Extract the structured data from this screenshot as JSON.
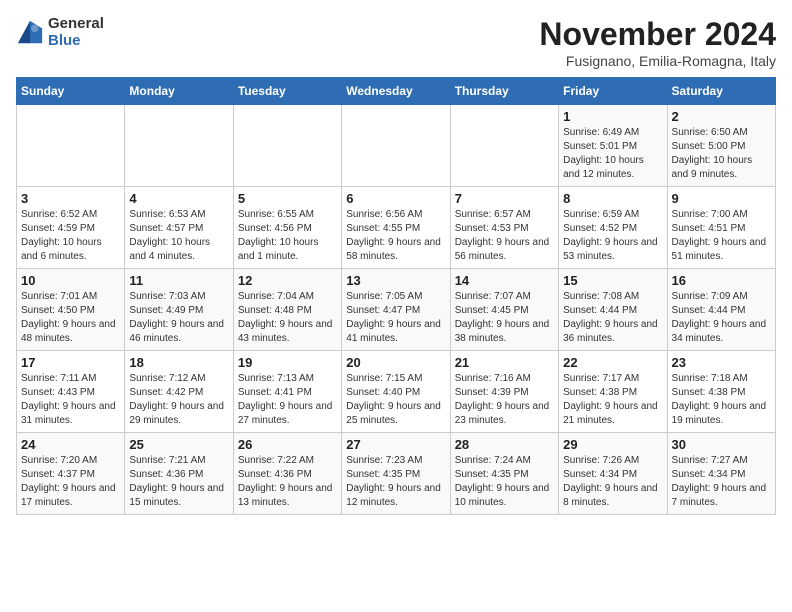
{
  "logo": {
    "general": "General",
    "blue": "Blue"
  },
  "title": "November 2024",
  "subtitle": "Fusignano, Emilia-Romagna, Italy",
  "headers": [
    "Sunday",
    "Monday",
    "Tuesday",
    "Wednesday",
    "Thursday",
    "Friday",
    "Saturday"
  ],
  "weeks": [
    [
      {
        "day": "",
        "info": ""
      },
      {
        "day": "",
        "info": ""
      },
      {
        "day": "",
        "info": ""
      },
      {
        "day": "",
        "info": ""
      },
      {
        "day": "",
        "info": ""
      },
      {
        "day": "1",
        "info": "Sunrise: 6:49 AM\nSunset: 5:01 PM\nDaylight: 10 hours and 12 minutes."
      },
      {
        "day": "2",
        "info": "Sunrise: 6:50 AM\nSunset: 5:00 PM\nDaylight: 10 hours and 9 minutes."
      }
    ],
    [
      {
        "day": "3",
        "info": "Sunrise: 6:52 AM\nSunset: 4:59 PM\nDaylight: 10 hours and 6 minutes."
      },
      {
        "day": "4",
        "info": "Sunrise: 6:53 AM\nSunset: 4:57 PM\nDaylight: 10 hours and 4 minutes."
      },
      {
        "day": "5",
        "info": "Sunrise: 6:55 AM\nSunset: 4:56 PM\nDaylight: 10 hours and 1 minute."
      },
      {
        "day": "6",
        "info": "Sunrise: 6:56 AM\nSunset: 4:55 PM\nDaylight: 9 hours and 58 minutes."
      },
      {
        "day": "7",
        "info": "Sunrise: 6:57 AM\nSunset: 4:53 PM\nDaylight: 9 hours and 56 minutes."
      },
      {
        "day": "8",
        "info": "Sunrise: 6:59 AM\nSunset: 4:52 PM\nDaylight: 9 hours and 53 minutes."
      },
      {
        "day": "9",
        "info": "Sunrise: 7:00 AM\nSunset: 4:51 PM\nDaylight: 9 hours and 51 minutes."
      }
    ],
    [
      {
        "day": "10",
        "info": "Sunrise: 7:01 AM\nSunset: 4:50 PM\nDaylight: 9 hours and 48 minutes."
      },
      {
        "day": "11",
        "info": "Sunrise: 7:03 AM\nSunset: 4:49 PM\nDaylight: 9 hours and 46 minutes."
      },
      {
        "day": "12",
        "info": "Sunrise: 7:04 AM\nSunset: 4:48 PM\nDaylight: 9 hours and 43 minutes."
      },
      {
        "day": "13",
        "info": "Sunrise: 7:05 AM\nSunset: 4:47 PM\nDaylight: 9 hours and 41 minutes."
      },
      {
        "day": "14",
        "info": "Sunrise: 7:07 AM\nSunset: 4:45 PM\nDaylight: 9 hours and 38 minutes."
      },
      {
        "day": "15",
        "info": "Sunrise: 7:08 AM\nSunset: 4:44 PM\nDaylight: 9 hours and 36 minutes."
      },
      {
        "day": "16",
        "info": "Sunrise: 7:09 AM\nSunset: 4:44 PM\nDaylight: 9 hours and 34 minutes."
      }
    ],
    [
      {
        "day": "17",
        "info": "Sunrise: 7:11 AM\nSunset: 4:43 PM\nDaylight: 9 hours and 31 minutes."
      },
      {
        "day": "18",
        "info": "Sunrise: 7:12 AM\nSunset: 4:42 PM\nDaylight: 9 hours and 29 minutes."
      },
      {
        "day": "19",
        "info": "Sunrise: 7:13 AM\nSunset: 4:41 PM\nDaylight: 9 hours and 27 minutes."
      },
      {
        "day": "20",
        "info": "Sunrise: 7:15 AM\nSunset: 4:40 PM\nDaylight: 9 hours and 25 minutes."
      },
      {
        "day": "21",
        "info": "Sunrise: 7:16 AM\nSunset: 4:39 PM\nDaylight: 9 hours and 23 minutes."
      },
      {
        "day": "22",
        "info": "Sunrise: 7:17 AM\nSunset: 4:38 PM\nDaylight: 9 hours and 21 minutes."
      },
      {
        "day": "23",
        "info": "Sunrise: 7:18 AM\nSunset: 4:38 PM\nDaylight: 9 hours and 19 minutes."
      }
    ],
    [
      {
        "day": "24",
        "info": "Sunrise: 7:20 AM\nSunset: 4:37 PM\nDaylight: 9 hours and 17 minutes."
      },
      {
        "day": "25",
        "info": "Sunrise: 7:21 AM\nSunset: 4:36 PM\nDaylight: 9 hours and 15 minutes."
      },
      {
        "day": "26",
        "info": "Sunrise: 7:22 AM\nSunset: 4:36 PM\nDaylight: 9 hours and 13 minutes."
      },
      {
        "day": "27",
        "info": "Sunrise: 7:23 AM\nSunset: 4:35 PM\nDaylight: 9 hours and 12 minutes."
      },
      {
        "day": "28",
        "info": "Sunrise: 7:24 AM\nSunset: 4:35 PM\nDaylight: 9 hours and 10 minutes."
      },
      {
        "day": "29",
        "info": "Sunrise: 7:26 AM\nSunset: 4:34 PM\nDaylight: 9 hours and 8 minutes."
      },
      {
        "day": "30",
        "info": "Sunrise: 7:27 AM\nSunset: 4:34 PM\nDaylight: 9 hours and 7 minutes."
      }
    ]
  ]
}
